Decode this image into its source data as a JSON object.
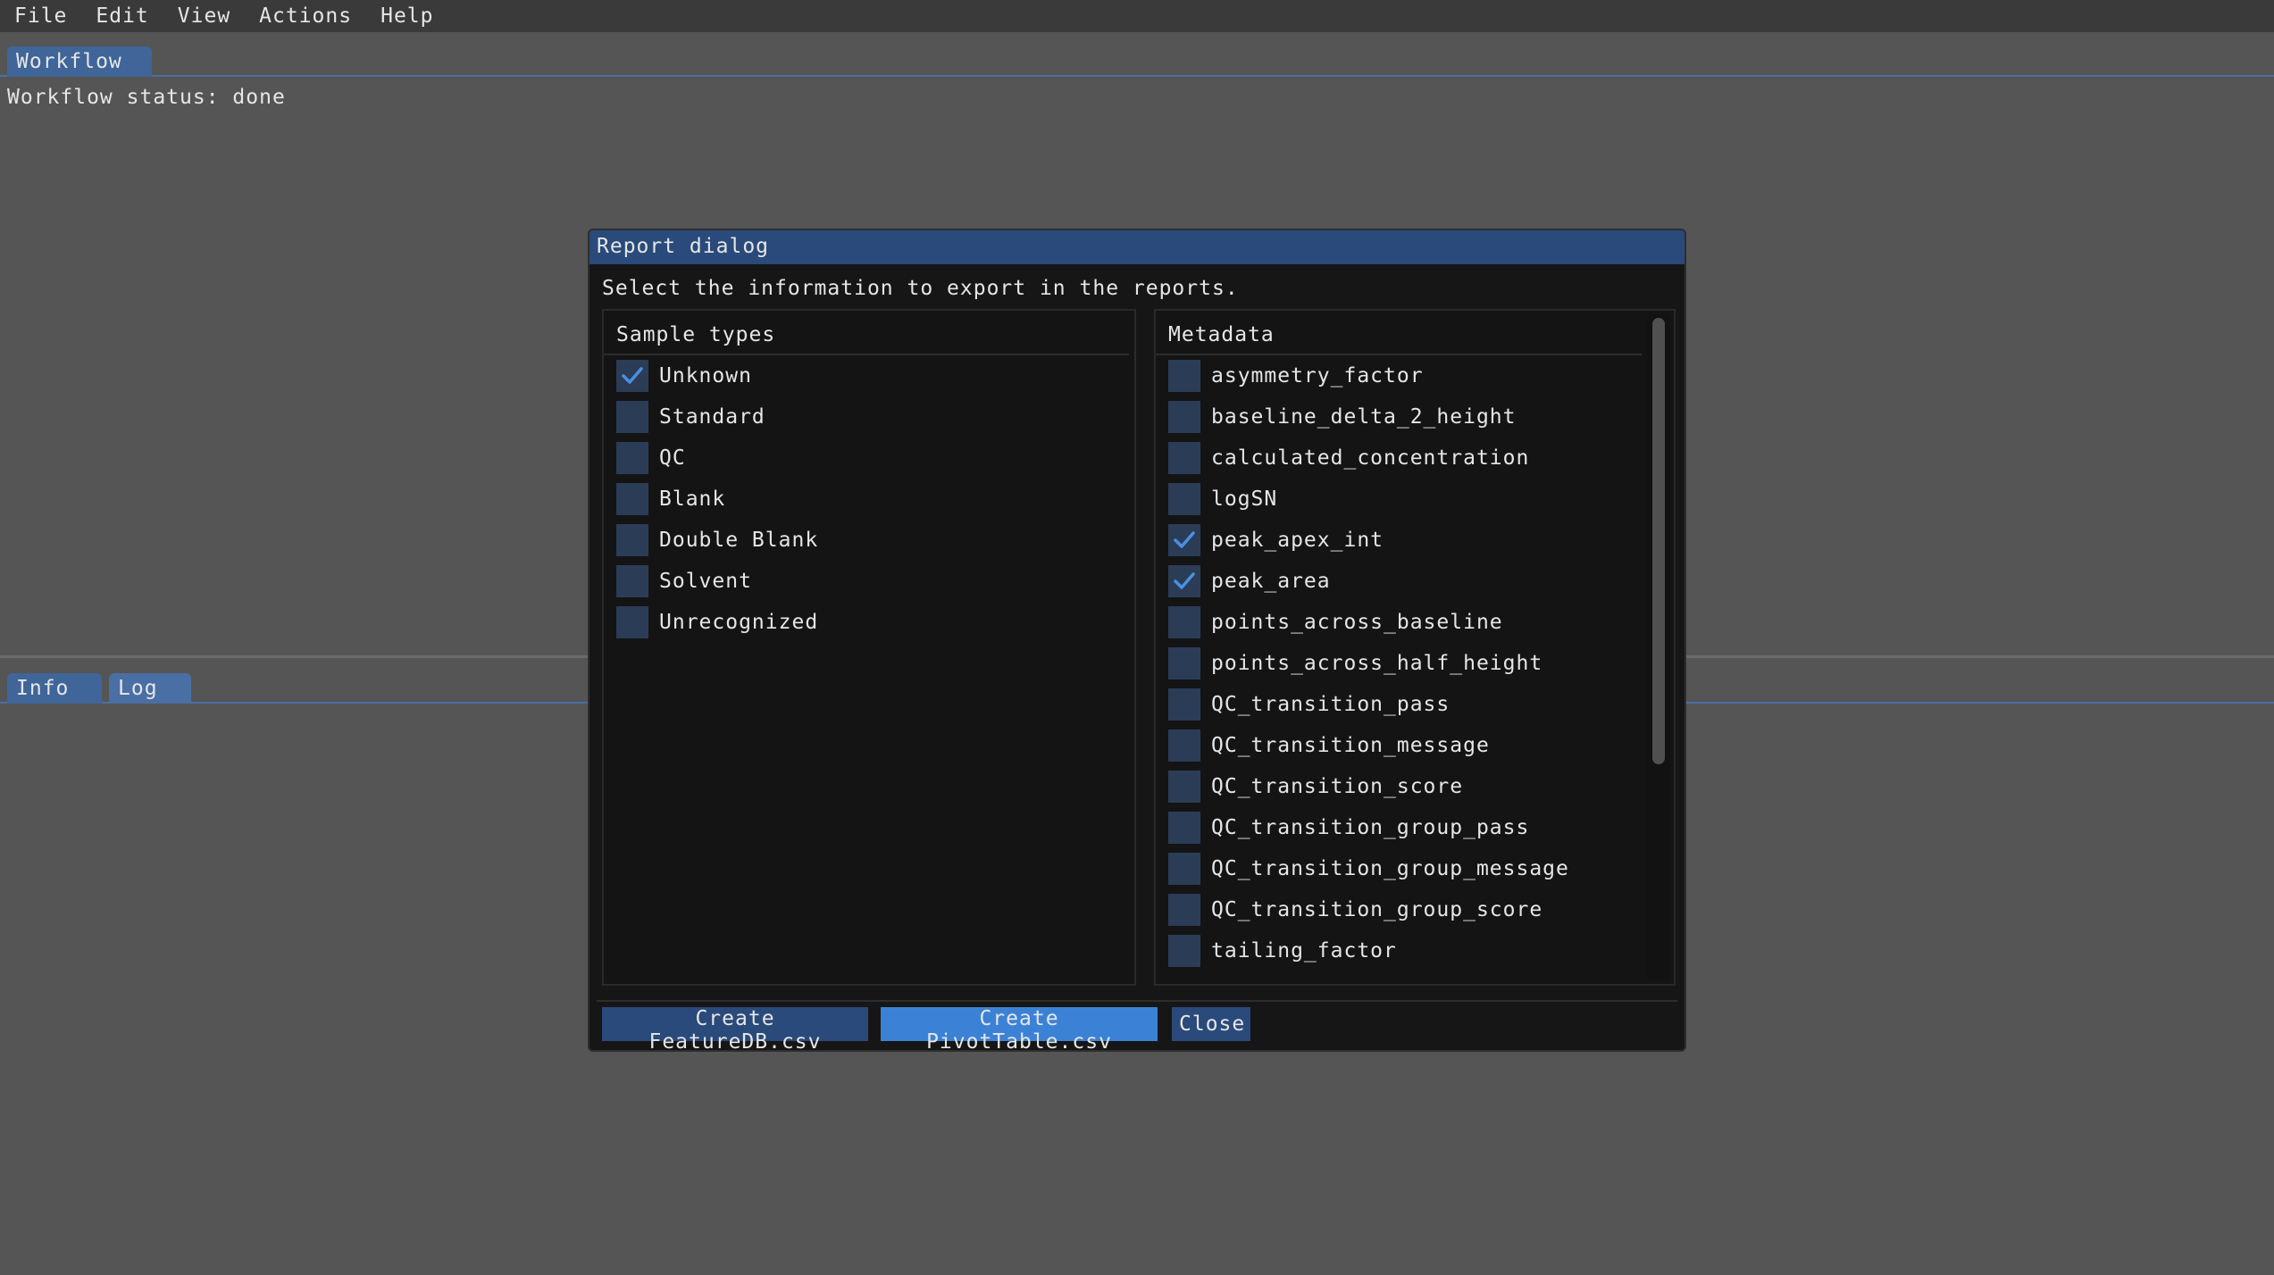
{
  "menubar": {
    "items": [
      "File",
      "Edit",
      "View",
      "Actions",
      "Help"
    ]
  },
  "top_tabs": {
    "workflow": "Workflow"
  },
  "workflow_status": "Workflow status: done",
  "bottom_tabs": {
    "info": "Info",
    "log": "Log"
  },
  "dialog": {
    "title": "Report dialog",
    "prompt": "Select the information to export in the reports.",
    "sample_types": {
      "header": "Sample types",
      "items": [
        {
          "label": "Unknown",
          "checked": true
        },
        {
          "label": "Standard",
          "checked": false
        },
        {
          "label": "QC",
          "checked": false
        },
        {
          "label": "Blank",
          "checked": false
        },
        {
          "label": "Double Blank",
          "checked": false
        },
        {
          "label": "Solvent",
          "checked": false
        },
        {
          "label": "Unrecognized",
          "checked": false
        }
      ]
    },
    "metadata": {
      "header": "Metadata",
      "items": [
        {
          "label": "asymmetry_factor",
          "checked": false
        },
        {
          "label": "baseline_delta_2_height",
          "checked": false
        },
        {
          "label": "calculated_concentration",
          "checked": false
        },
        {
          "label": "logSN",
          "checked": false
        },
        {
          "label": "peak_apex_int",
          "checked": true
        },
        {
          "label": "peak_area",
          "checked": true
        },
        {
          "label": "points_across_baseline",
          "checked": false
        },
        {
          "label": "points_across_half_height",
          "checked": false
        },
        {
          "label": "QC_transition_pass",
          "checked": false
        },
        {
          "label": "QC_transition_message",
          "checked": false
        },
        {
          "label": "QC_transition_score",
          "checked": false
        },
        {
          "label": "QC_transition_group_pass",
          "checked": false
        },
        {
          "label": "QC_transition_group_message",
          "checked": false
        },
        {
          "label": "QC_transition_group_score",
          "checked": false
        },
        {
          "label": "tailing_factor",
          "checked": false
        }
      ]
    },
    "buttons": {
      "feature_db": "Create FeatureDB.csv",
      "pivot_table": "Create PivotTable.csv",
      "close": "Close"
    }
  },
  "colors": {
    "accent": "#3b82d6",
    "checkmark": "#4a90e2",
    "title_bar": "#294a7a",
    "checkbox_bg": "#2b3c57"
  },
  "icons": {
    "check": "check-icon"
  }
}
